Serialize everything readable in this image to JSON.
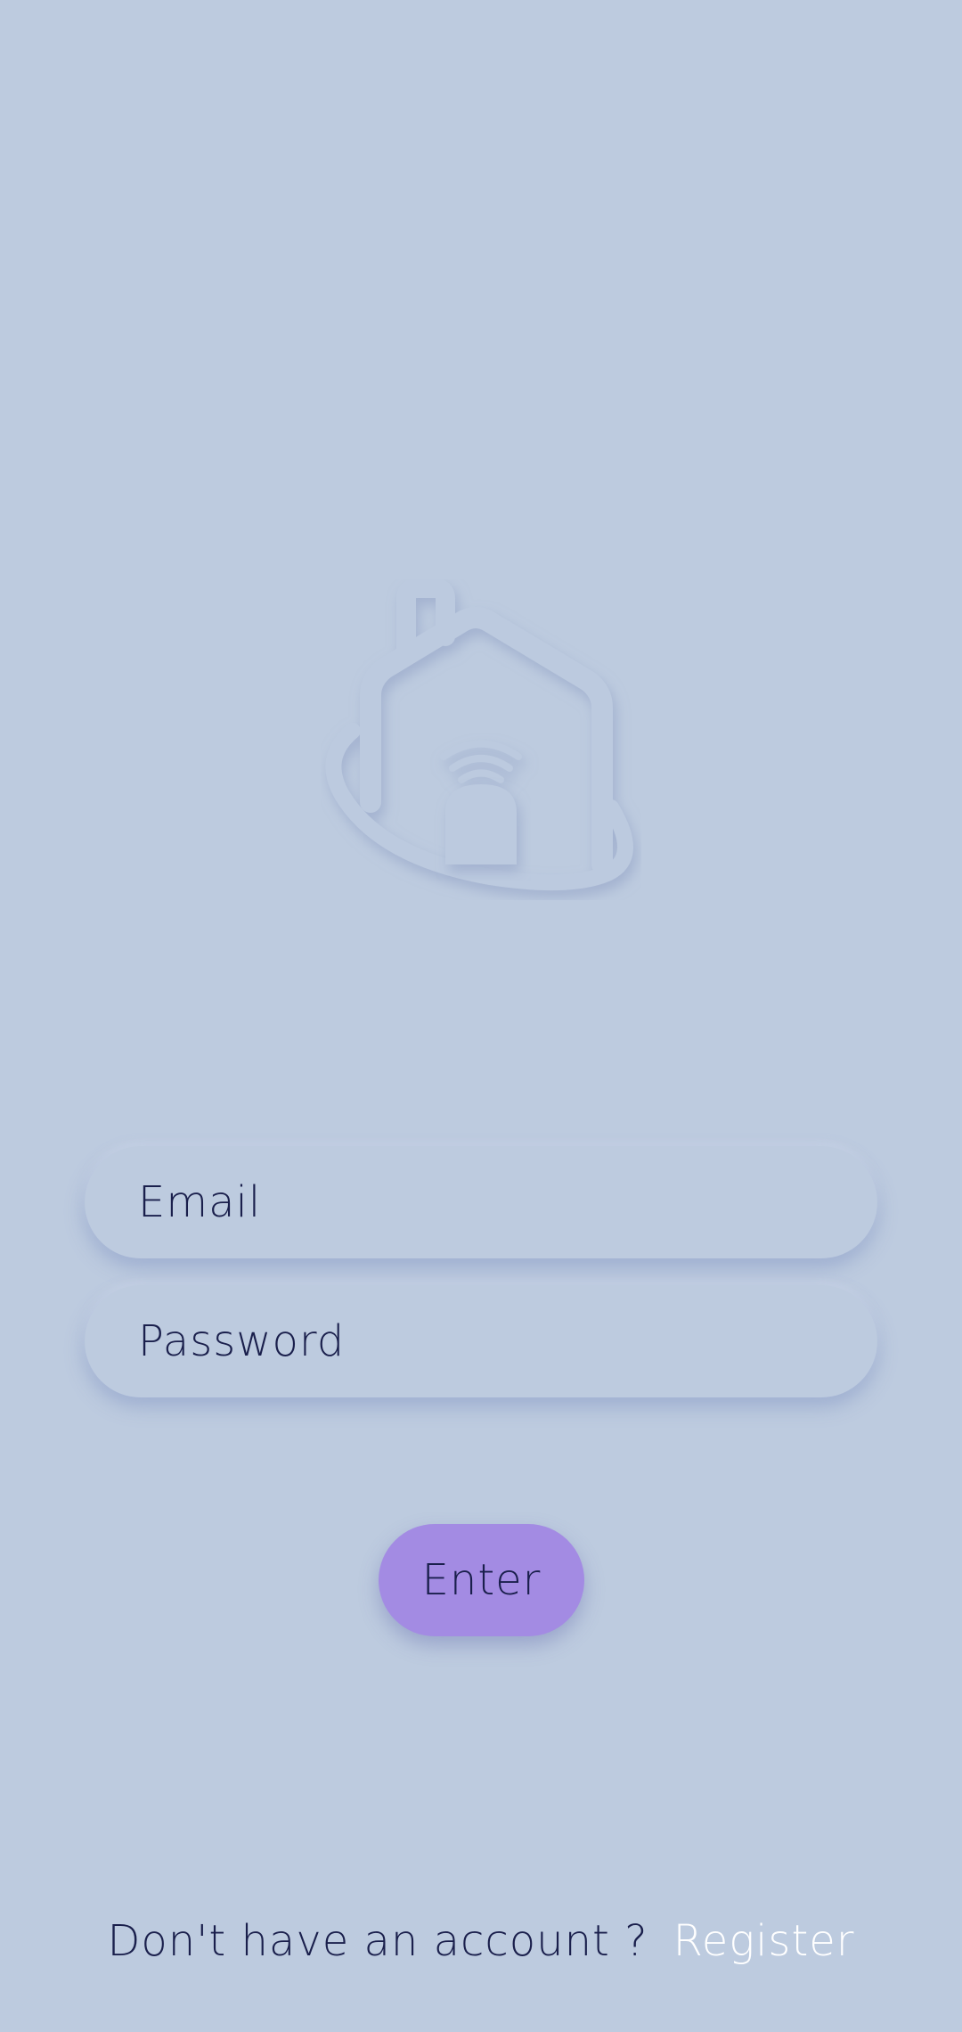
{
  "logo": {
    "icon": "smart-home-icon"
  },
  "form": {
    "email_label": "Email",
    "password_label": "Password",
    "enter_label": "Enter"
  },
  "footer": {
    "prompt": "Don't have an account ?",
    "register_label": "Register"
  },
  "colors": {
    "background": "#bdcbdf",
    "accent": "#a38be3",
    "text_dark": "#1a1f4c",
    "text_light": "#ffffff"
  }
}
